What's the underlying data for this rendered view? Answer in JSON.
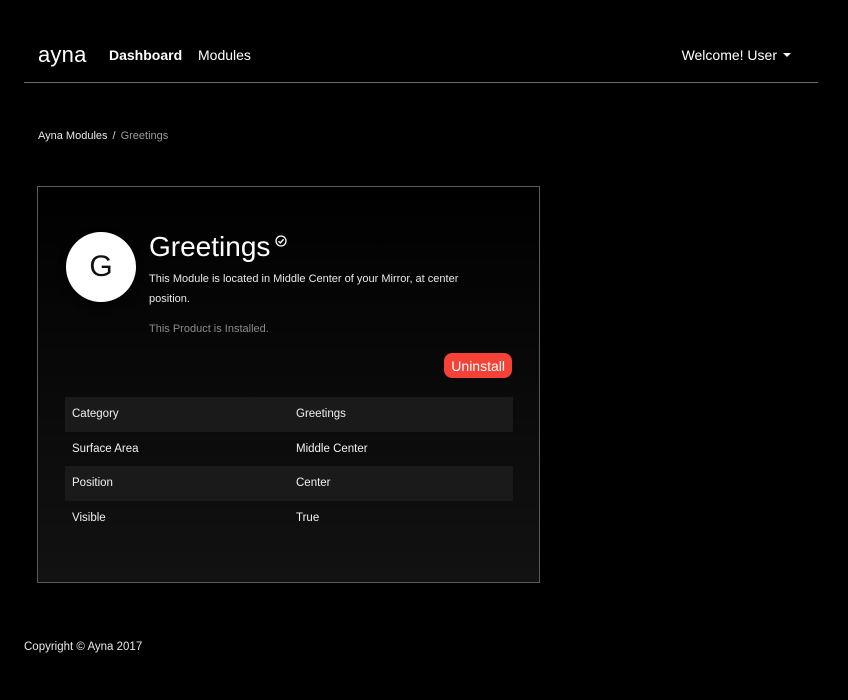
{
  "nav": {
    "brand": "ayna",
    "dashboard_label": "Dashboard",
    "modules_label": "Modules",
    "user_label": "Welcome! User"
  },
  "breadcrumb": {
    "parent": "Ayna Modules",
    "separator": "/",
    "current": "Greetings"
  },
  "module": {
    "avatar_letter": "G",
    "title": "Greetings",
    "description": "This Module is located in Middle Center of your Mirror, at center position.",
    "status": "This Product is Installed.",
    "uninstall_label": "Uninstall",
    "uninstall_color": "#f44336",
    "details": [
      {
        "label": "Category",
        "value": "Greetings"
      },
      {
        "label": "Surface Area",
        "value": "Middle Center"
      },
      {
        "label": "Position",
        "value": "Center"
      },
      {
        "label": "Visible",
        "value": "True"
      }
    ]
  },
  "footer": {
    "copyright": "Copyright © Ayna 2017"
  }
}
